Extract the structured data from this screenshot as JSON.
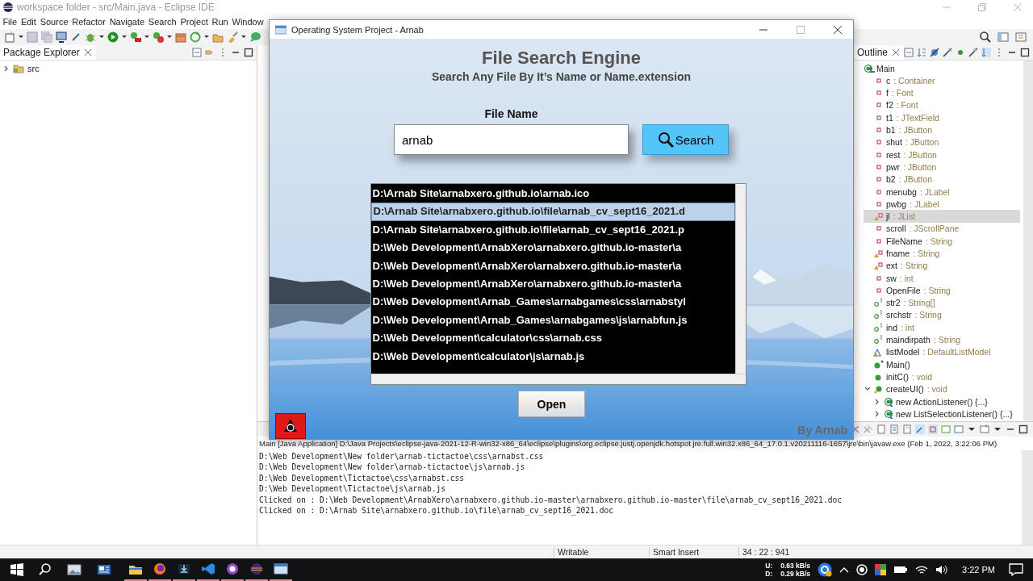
{
  "ide": {
    "title": "workspace folder - src/Main.java - Eclipse IDE",
    "menu": [
      "File",
      "Edit",
      "Source",
      "Refactor",
      "Navigate",
      "Search",
      "Project",
      "Run",
      "Window"
    ],
    "package_explorer": {
      "title": "Package Explorer",
      "tree": [
        {
          "label": "src",
          "expanded": false
        }
      ]
    },
    "outline": {
      "title": "Outline",
      "tree": [
        {
          "name": "Main",
          "kind": "class",
          "selected": false,
          "children": [
            {
              "name": "c",
              "type": ": Container",
              "kind": "private-field",
              "selected": false
            },
            {
              "name": "f",
              "type": ": Font",
              "kind": "private-field",
              "selected": false
            },
            {
              "name": "f2",
              "type": ": Font",
              "kind": "private-field",
              "selected": false
            },
            {
              "name": "t1",
              "type": ": JTextField",
              "kind": "private-field",
              "selected": false
            },
            {
              "name": "b1",
              "type": ": JButton",
              "kind": "private-field",
              "selected": false
            },
            {
              "name": "shut",
              "type": ": JButton",
              "kind": "private-field",
              "selected": false
            },
            {
              "name": "rest",
              "type": ": JButton",
              "kind": "private-field",
              "selected": false
            },
            {
              "name": "pwr",
              "type": ": JButton",
              "kind": "private-field",
              "selected": false
            },
            {
              "name": "b2",
              "type": ": JButton",
              "kind": "private-field",
              "selected": false
            },
            {
              "name": "menubg",
              "type": ": JLabel",
              "kind": "private-field",
              "selected": false
            },
            {
              "name": "pwbg",
              "type": ": JLabel",
              "kind": "private-field",
              "selected": false
            },
            {
              "name": "jl",
              "type": ": JList",
              "kind": "decorated-field",
              "selected": true
            },
            {
              "name": "scroll",
              "type": ": JScrollPane",
              "kind": "private-field",
              "selected": false
            },
            {
              "name": "FileName",
              "type": ": String",
              "kind": "private-field",
              "selected": false
            },
            {
              "name": "fname",
              "type": ": String",
              "kind": "decorated-field",
              "selected": false
            },
            {
              "name": "ext",
              "type": ": String",
              "kind": "decorated-field",
              "selected": false
            },
            {
              "name": "sw",
              "type": ": int",
              "kind": "private-field",
              "selected": false
            },
            {
              "name": "OpenFile",
              "type": ": String",
              "kind": "private-field",
              "selected": false
            },
            {
              "name": "str2",
              "type": ": String[]",
              "kind": "static-field",
              "selected": false
            },
            {
              "name": "srchstr",
              "type": ": String",
              "kind": "static-field",
              "selected": false
            },
            {
              "name": "ind",
              "type": ": int",
              "kind": "static-field",
              "selected": false
            },
            {
              "name": "maindirpath",
              "type": ": String",
              "kind": "static-field",
              "selected": false
            },
            {
              "name": "listModel",
              "type": ": DefaultListModel",
              "kind": "package-field",
              "selected": false
            },
            {
              "name": "Main()",
              "kind": "constructor",
              "selected": false
            },
            {
              "name": "initC()",
              "type": ": void",
              "kind": "method",
              "selected": false
            },
            {
              "name": "createUI()",
              "type": ": void",
              "kind": "protected-method",
              "selected": false,
              "expanded": true,
              "children": [
                {
                  "name": "new ActionListener() {...}",
                  "kind": "anonymous-class",
                  "selected": false,
                  "expanded": false
                },
                {
                  "name": "new ListSelectionListener() {...}",
                  "kind": "anonymous-class",
                  "selected": false,
                  "expanded": false
                }
              ]
            }
          ]
        }
      ]
    },
    "console": {
      "header": "Main [Java Application] D:\\Java Projects\\eclipse-java-2021-12-R-win32-x86_64\\eclipse\\plugins\\org.eclipse.justj.openjdk.hotspot.jre.full.win32.x86_64_17.0.1.v20211116-1657\\jre\\bin\\javaw.exe  (Feb 1, 2022, 3:22:06 PM)",
      "lines": [
        "D:\\Web Development\\New folder\\arnab-tictactoe\\css\\arnabst.css",
        "D:\\Web Development\\New folder\\arnab-tictactoe\\js\\arnab.js",
        "D:\\Web Development\\Tictactoe\\css\\arnabst.css",
        "D:\\Web Development\\Tictactoe\\js\\arnab.js",
        "Clicked on : D:\\Web Development\\ArnabXero\\arnabxero.github.io-master\\arnabxero.github.io-master\\file\\arnab_cv_sept16_2021.doc",
        "Clicked on : D:\\Arnab Site\\arnabxero.github.io\\file\\arnab_cv_sept16_2021.doc"
      ]
    },
    "status_bar": [
      "Writable",
      "Smart Insert",
      "34 : 22 : 941"
    ]
  },
  "app": {
    "title": "Operating System Project - Arnab",
    "heading": "File Search Engine",
    "subheading": "Search Any File By It’s Name or Name.extension",
    "field_label": "File Name",
    "search_field": {
      "value": "arnab"
    },
    "search_button": "Search",
    "results": [
      {
        "path": "D:\\Arnab Site\\arnabxero.github.io\\arnab.ico",
        "selected": false
      },
      {
        "path": "D:\\Arnab Site\\arnabxero.github.io\\file\\arnab_cv_sept16_2021.d",
        "selected": true
      },
      {
        "path": "D:\\Arnab Site\\arnabxero.github.io\\file\\arnab_cv_sept16_2021.p",
        "selected": false
      },
      {
        "path": "D:\\Web Development\\ArnabXero\\arnabxero.github.io-master\\a",
        "selected": false
      },
      {
        "path": "D:\\Web Development\\ArnabXero\\arnabxero.github.io-master\\a",
        "selected": false
      },
      {
        "path": "D:\\Web Development\\ArnabXero\\arnabxero.github.io-master\\a",
        "selected": false
      },
      {
        "path": "D:\\Web Development\\Arnab_Games\\arnabgames\\css\\arnabstyl",
        "selected": false
      },
      {
        "path": "D:\\Web Development\\Arnab_Games\\arnabgames\\js\\arnabfun.js",
        "selected": false
      },
      {
        "path": "D:\\Web Development\\calculator\\css\\arnab.css",
        "selected": false
      },
      {
        "path": "D:\\Web Development\\calculator\\js\\arnab.js",
        "selected": false
      }
    ],
    "open_button": "Open",
    "credit": "By Arnab"
  },
  "taskbar": {
    "upload_label": "U:",
    "upload_rate": "0.63 kB/s",
    "download_label": "D:",
    "download_rate": "0.29 kB/s",
    "time": "3:22 PM"
  }
}
